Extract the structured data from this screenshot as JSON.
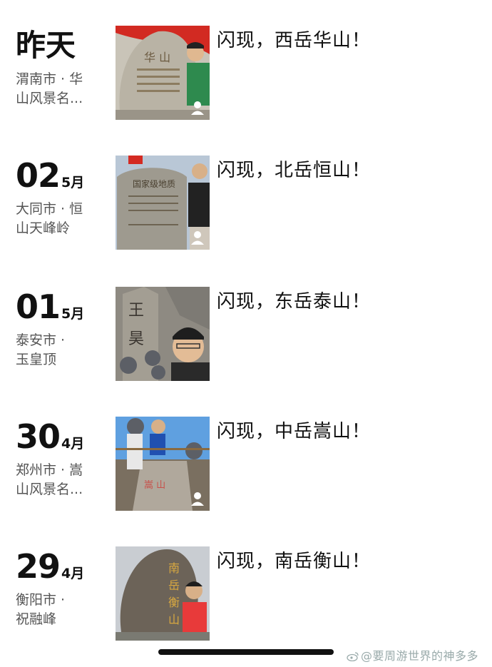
{
  "entries": [
    {
      "date_label": "昨天",
      "day": "",
      "month": "",
      "location_line1": "渭南市 · 华",
      "location_line2": "山风景名...",
      "caption": "闪现，西岳华山！",
      "photo_icon": "mountain-stone-photo"
    },
    {
      "date_label": "",
      "day": "02",
      "month": "5月",
      "location_line1": "大同市 · 恒",
      "location_line2": "山天峰岭",
      "caption": "闪现，北岳恒山！",
      "photo_icon": "mountain-stone-photo"
    },
    {
      "date_label": "",
      "day": "01",
      "month": "5月",
      "location_line1": "泰安市 ·",
      "location_line2": "玉皇顶",
      "caption": "闪现，东岳泰山！",
      "photo_icon": "mountain-stone-photo"
    },
    {
      "date_label": "",
      "day": "30",
      "month": "4月",
      "location_line1": "郑州市 · 嵩",
      "location_line2": "山风景名...",
      "caption": "闪现，中岳嵩山！",
      "photo_icon": "mountain-stone-photo"
    },
    {
      "date_label": "",
      "day": "29",
      "month": "4月",
      "location_line1": "衡阳市 ·",
      "location_line2": "祝融峰",
      "caption": "闪现，南岳衡山！",
      "photo_icon": "mountain-stone-photo"
    }
  ],
  "watermark": "@要周游世界的神多多"
}
